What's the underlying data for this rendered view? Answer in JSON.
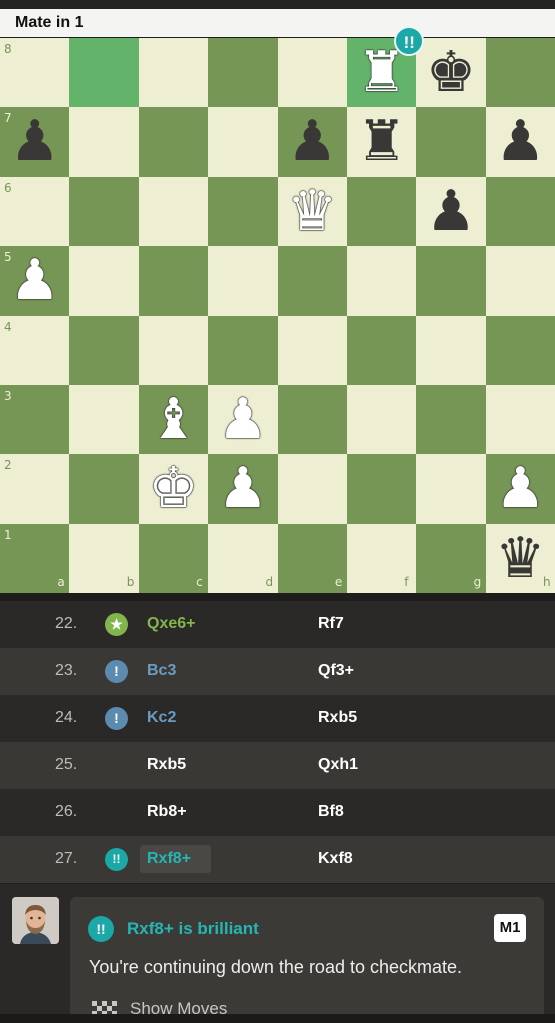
{
  "header": {
    "title": "Mate in 1"
  },
  "board": {
    "ranks": [
      "8",
      "7",
      "6",
      "5",
      "4",
      "3",
      "2",
      "1"
    ],
    "files": [
      "a",
      "b",
      "c",
      "d",
      "e",
      "f",
      "g",
      "h"
    ],
    "highlight_squares": [
      "b8",
      "f8"
    ],
    "pieces": [
      {
        "sq": "f8",
        "color": "w",
        "type": "rook",
        "glyph": "♜",
        "name": "white-rook-icon"
      },
      {
        "sq": "g8",
        "color": "b",
        "type": "king",
        "glyph": "♚",
        "name": "black-king-icon"
      },
      {
        "sq": "a7",
        "color": "b",
        "type": "pawn",
        "glyph": "♟",
        "name": "black-pawn-icon"
      },
      {
        "sq": "e7",
        "color": "b",
        "type": "pawn",
        "glyph": "♟",
        "name": "black-pawn-icon"
      },
      {
        "sq": "f7",
        "color": "b",
        "type": "rook",
        "glyph": "♜",
        "name": "black-rook-icon"
      },
      {
        "sq": "h7",
        "color": "b",
        "type": "pawn",
        "glyph": "♟",
        "name": "black-pawn-icon"
      },
      {
        "sq": "e6",
        "color": "w",
        "type": "queen",
        "glyph": "♛",
        "name": "white-queen-icon"
      },
      {
        "sq": "g6",
        "color": "b",
        "type": "pawn",
        "glyph": "♟",
        "name": "black-pawn-icon"
      },
      {
        "sq": "a5",
        "color": "w",
        "type": "pawn",
        "glyph": "♟",
        "name": "white-pawn-icon"
      },
      {
        "sq": "c3",
        "color": "w",
        "type": "bishop",
        "glyph": "♝",
        "name": "white-bishop-icon"
      },
      {
        "sq": "d3",
        "color": "w",
        "type": "pawn",
        "glyph": "♟",
        "name": "white-pawn-icon"
      },
      {
        "sq": "c2",
        "color": "w",
        "type": "king",
        "glyph": "♚",
        "name": "white-king-icon"
      },
      {
        "sq": "d2",
        "color": "w",
        "type": "pawn",
        "glyph": "♟",
        "name": "white-pawn-icon"
      },
      {
        "sq": "h2",
        "color": "w",
        "type": "pawn",
        "glyph": "♟",
        "name": "white-pawn-icon"
      },
      {
        "sq": "h1",
        "color": "b",
        "type": "queen",
        "glyph": "♛",
        "name": "black-queen-icon"
      }
    ],
    "move_badge": {
      "sq": "f8",
      "text": "!!",
      "icon": "brilliant-icon"
    }
  },
  "moves": [
    {
      "num": "22.",
      "icon": "best-move-icon",
      "icon_text": "★",
      "icon_color": "#81b64c",
      "white": "Qxe6+",
      "white_color": "#81b64c",
      "black": "Rf7"
    },
    {
      "num": "23.",
      "icon": "great-move-icon",
      "icon_text": "!",
      "icon_color": "#5c8bb0",
      "white": "Bc3",
      "white_color": "#6a9bc3",
      "black": "Qf3+"
    },
    {
      "num": "24.",
      "icon": "great-move-icon",
      "icon_text": "!",
      "icon_color": "#5c8bb0",
      "white": "Kc2",
      "white_color": "#6a9bc3",
      "black": "Rxb5"
    },
    {
      "num": "25.",
      "icon": "",
      "icon_text": "",
      "icon_color": "",
      "white": "Rxb5",
      "white_color": "#ffffff",
      "black": "Qxh1"
    },
    {
      "num": "26.",
      "icon": "",
      "icon_text": "",
      "icon_color": "",
      "white": "Rb8+",
      "white_color": "#ffffff",
      "black": "Bf8"
    },
    {
      "num": "27.",
      "icon": "brilliant-icon",
      "icon_text": "!!",
      "icon_color": "#1ba8a7",
      "white": "Rxf8+",
      "white_color": "#25b6b3",
      "black": "Kxf8",
      "selected": true
    }
  ],
  "coach": {
    "icon_text": "!!",
    "title": "Rxf8+ is brilliant",
    "badge": "M1",
    "message": "You're continuing down the road to checkmate.",
    "show_moves": "Show Moves"
  }
}
